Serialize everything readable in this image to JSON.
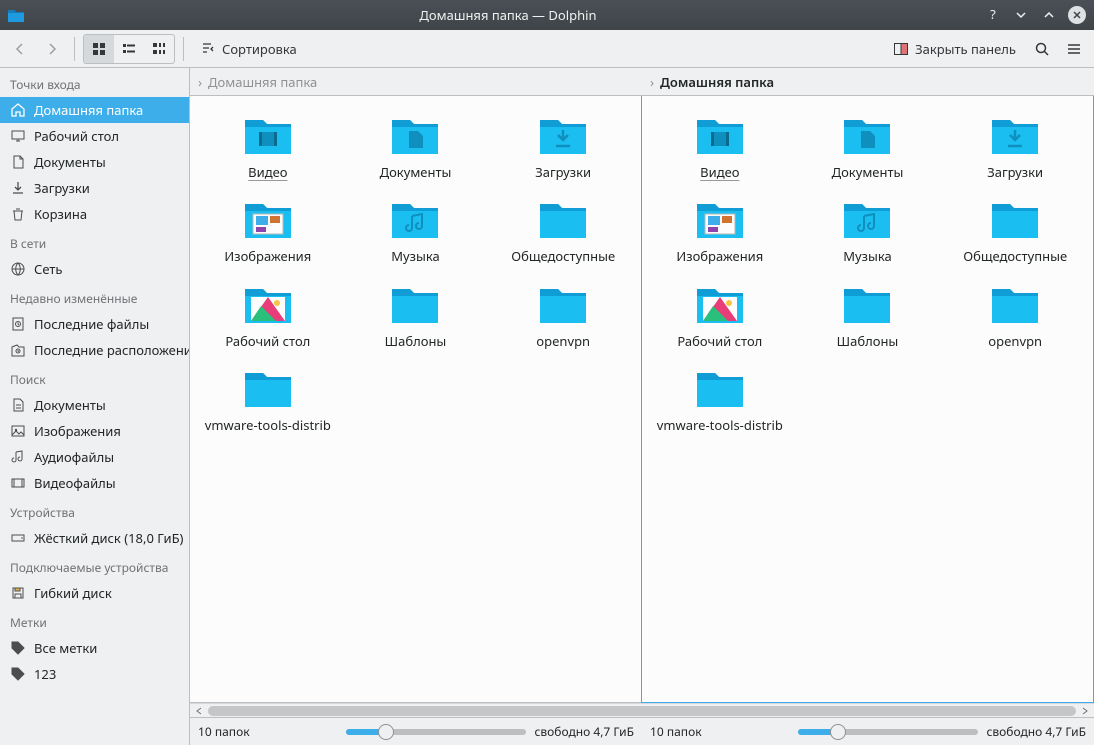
{
  "window": {
    "title": "Домашняя папка — Dolphin"
  },
  "toolbar": {
    "sort_label": "Сортировка",
    "close_panel_label": "Закрыть панель"
  },
  "sidebar": {
    "sections": [
      {
        "header": "Точки входа",
        "items": [
          {
            "label": "Домашняя папка",
            "icon": "home",
            "active": true
          },
          {
            "label": "Рабочий стол",
            "icon": "desktop"
          },
          {
            "label": "Документы",
            "icon": "document"
          },
          {
            "label": "Загрузки",
            "icon": "download"
          },
          {
            "label": "Корзина",
            "icon": "trash"
          }
        ]
      },
      {
        "header": "В сети",
        "items": [
          {
            "label": "Сеть",
            "icon": "network"
          }
        ]
      },
      {
        "header": "Недавно изменённые",
        "items": [
          {
            "label": "Последние файлы",
            "icon": "recent-files"
          },
          {
            "label": "Последние расположения",
            "icon": "recent-places"
          }
        ]
      },
      {
        "header": "Поиск",
        "items": [
          {
            "label": "Документы",
            "icon": "search-doc"
          },
          {
            "label": "Изображения",
            "icon": "search-image"
          },
          {
            "label": "Аудиофайлы",
            "icon": "search-audio"
          },
          {
            "label": "Видеофайлы",
            "icon": "search-video"
          }
        ]
      },
      {
        "header": "Устройства",
        "items": [
          {
            "label": "Жёсткий диск (18,0 ГиБ)",
            "icon": "hdd"
          }
        ]
      },
      {
        "header": "Подключаемые устройства",
        "items": [
          {
            "label": "Гибкий диск",
            "icon": "floppy"
          }
        ]
      },
      {
        "header": "Метки",
        "items": [
          {
            "label": "Все метки",
            "icon": "tag"
          },
          {
            "label": "123",
            "icon": "tag"
          }
        ]
      }
    ]
  },
  "breadcrumb": {
    "left": "Домашняя папка",
    "right": "Домашняя папка"
  },
  "pane": {
    "items": [
      {
        "label": "Видео",
        "type": "video",
        "underline": true
      },
      {
        "label": "Документы",
        "type": "document"
      },
      {
        "label": "Загрузки",
        "type": "download"
      },
      {
        "label": "Изображения",
        "type": "images"
      },
      {
        "label": "Музыка",
        "type": "music"
      },
      {
        "label": "Общедоступные",
        "type": "folder"
      },
      {
        "label": "Рабочий стол",
        "type": "desktop"
      },
      {
        "label": "Шаблоны",
        "type": "folder"
      },
      {
        "label": "openvpn",
        "type": "folder"
      },
      {
        "label": "vmware-tools-distrib",
        "type": "folder"
      }
    ]
  },
  "status": {
    "count_text": "10 папок",
    "free_text": "свободно 4,7 ГиБ"
  }
}
